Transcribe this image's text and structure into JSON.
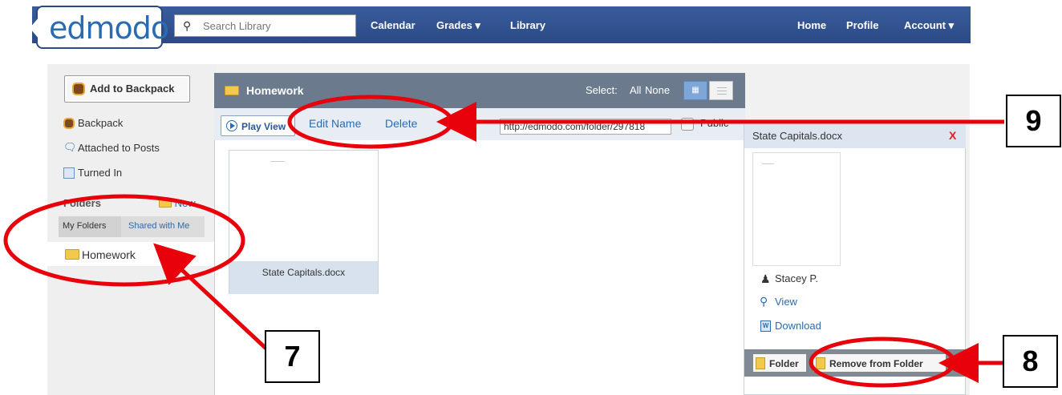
{
  "brand": {
    "logo_text": "edmodo"
  },
  "search": {
    "placeholder": "Search Library"
  },
  "topnav": {
    "calendar": "Calendar",
    "grades": "Grades ▾",
    "library": "Library",
    "home": "Home",
    "profile": "Profile",
    "account": "Account ▾"
  },
  "sidebar": {
    "add_backpack": "Add to Backpack",
    "backpack": "Backpack",
    "attached": "Attached to Posts",
    "turned_in": "Turned In",
    "folders_heading": "Folders",
    "new_folder": "New",
    "tab_my": "My Folders",
    "tab_shared": "Shared with Me",
    "folder_item": "Homework"
  },
  "main": {
    "title": "Homework",
    "select_label": "Select:",
    "select_all": "All",
    "select_none": "None",
    "play_view": "Play View",
    "edit_name": "Edit Name",
    "delete": "Delete",
    "url": "http://edmodo.com/folder/297818",
    "public_label": "Public",
    "file_caption": "State Capitals.docx"
  },
  "detail": {
    "filename": "State Capitals.docx",
    "close": "X",
    "owner": "Stacey P.",
    "view": "View",
    "download": "Download",
    "folder_btn": "Folder",
    "remove_btn": "Remove from Folder"
  },
  "annotations": {
    "seven": "7",
    "eight": "8",
    "nine": "9"
  },
  "colors": {
    "topbar": "#2b4a85",
    "link": "#2b6cb0",
    "annotation": "#e8000b"
  }
}
